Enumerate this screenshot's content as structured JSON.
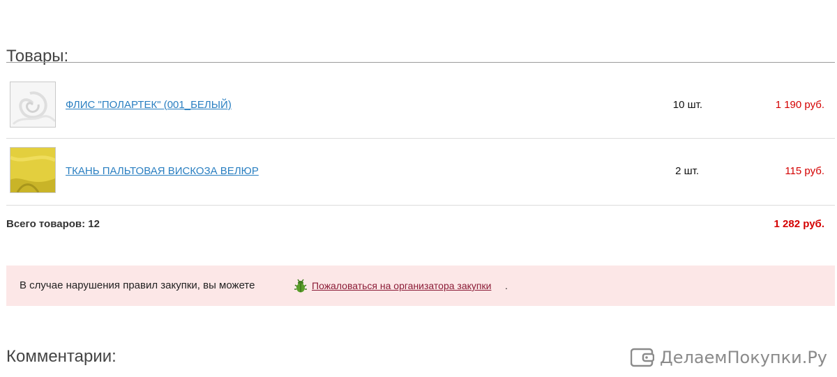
{
  "goods_section": {
    "title": "Товары:"
  },
  "products": [
    {
      "name": "ФЛИС \"ПОЛАРТЕК\" (001_БЕЛЫЙ)",
      "quantity": "10 шт.",
      "price": "1 190 руб.",
      "thumb_color": "#f4f4f4"
    },
    {
      "name": "ТКАНЬ ПАЛЬТОВАЯ ВИСКОЗА ВЕЛЮР",
      "quantity": "2 шт.",
      "price": "115 руб.",
      "thumb_color": "#e3cf3e"
    }
  ],
  "summary": {
    "total_label": "Всего товаров: 12",
    "total_value": "1 282 руб."
  },
  "notice": {
    "text": "В случае нарушения правил закупки, вы можете",
    "link": "Пожаловаться на организатора закупки",
    "trailing": ".",
    "icon": "bug-icon"
  },
  "comments_section": {
    "title": "Комментарии:"
  },
  "brand": {
    "text": "ДелаемПокупки.Ру",
    "icon": "wallet-logo-icon"
  },
  "colors": {
    "link": "#2a7fc1",
    "price": "#d40000",
    "notice_bg": "#fce7e7",
    "complain_link": "#8b1b36"
  }
}
